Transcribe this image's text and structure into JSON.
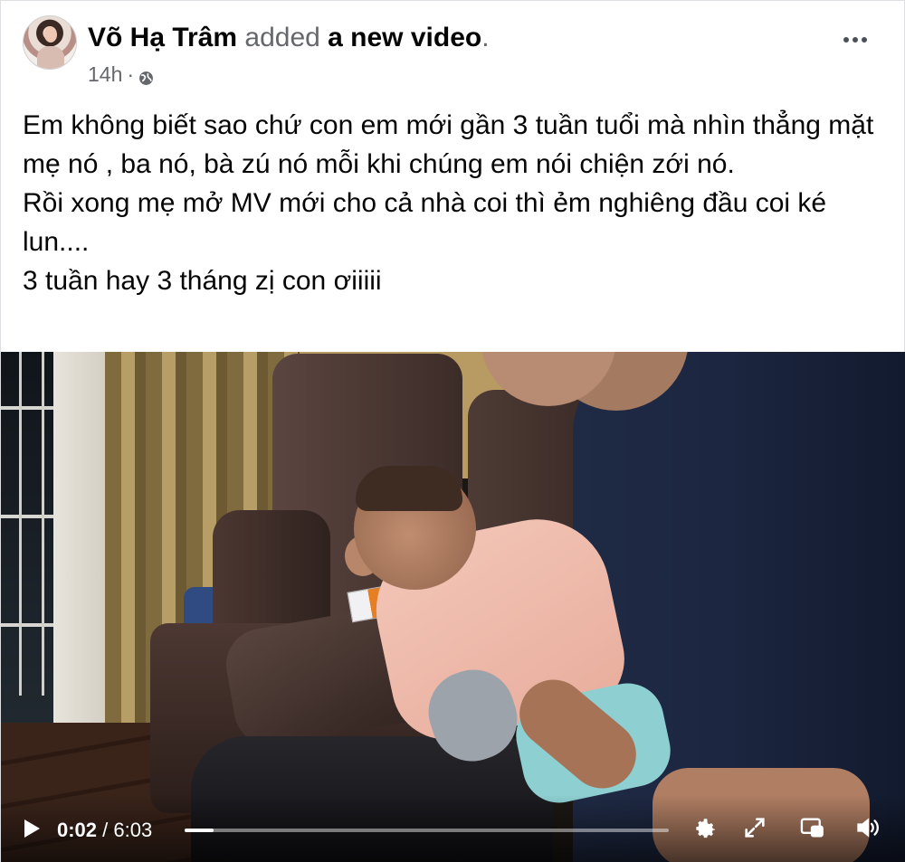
{
  "post": {
    "author": "Võ Hạ Trâm",
    "action": " added ",
    "target": "a new video",
    "target_suffix": ".",
    "timestamp": "14h",
    "meta_separator": " · ",
    "privacy_icon": "globe-icon",
    "more_icon": "more-options-icon"
  },
  "body": {
    "lines": [
      "Em không biết sao chứ con em mới gần 3 tuần tuổi mà nhìn thẳng mặt mẹ nó , ba nó, bà zú nó mỗi khi chúng em nói chiện zới nó.",
      "Rồi xong mẹ mở MV mới cho cả nhà coi thì ẻm nghiêng đầu coi ké lun....",
      "3 tuần hay 3 tháng zị con ơiiiii"
    ]
  },
  "video": {
    "current_time": "0:02",
    "separator": " / ",
    "duration": "6:03",
    "progress_fraction": 0.0055,
    "icons": [
      "play-icon",
      "settings-icon",
      "expand-icon",
      "picture-in-picture-icon",
      "volume-icon"
    ]
  },
  "colors": {
    "author": "#050505",
    "secondary": "#65676b",
    "video_bg": "#1b1714"
  }
}
